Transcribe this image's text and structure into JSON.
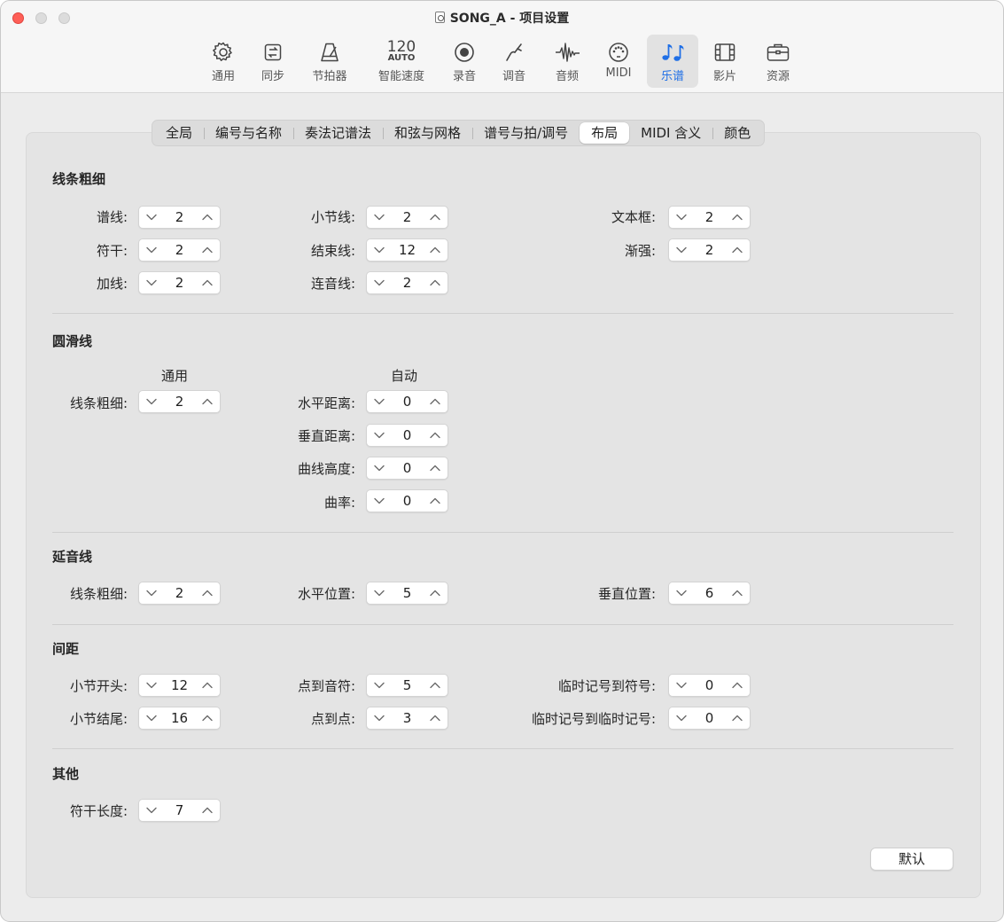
{
  "window": {
    "title": "SONG_A - 项目设置"
  },
  "toolbar": {
    "items": [
      {
        "label": "通用",
        "icon": "gear-icon"
      },
      {
        "label": "同步",
        "icon": "sync-icon"
      },
      {
        "label": "节拍器",
        "icon": "metronome-icon"
      },
      {
        "label": "智能速度",
        "icon": "tempo-icon",
        "tempo_value": "120",
        "tempo_mode": "AUTO"
      },
      {
        "label": "录音",
        "icon": "record-icon"
      },
      {
        "label": "调音",
        "icon": "tuning-fork-icon"
      },
      {
        "label": "音频",
        "icon": "waveform-icon"
      },
      {
        "label": "MIDI",
        "icon": "midi-port-icon"
      },
      {
        "label": "乐谱",
        "icon": "score-notes-icon",
        "active": true
      },
      {
        "label": "影片",
        "icon": "film-icon"
      },
      {
        "label": "资源",
        "icon": "briefcase-icon"
      }
    ],
    "active_color": "#1f6fe6"
  },
  "tabs": [
    "全局",
    "编号与名称",
    "奏法记谱法",
    "和弦与网格",
    "谱号与拍/调号",
    "布局",
    "MIDI 含义",
    "颜色"
  ],
  "active_tab": "布局",
  "sections": {
    "line_width": {
      "title": "线条粗细",
      "staff": {
        "label": "谱线:",
        "value": "2"
      },
      "stem": {
        "label": "符干:",
        "value": "2"
      },
      "ledger": {
        "label": "加线:",
        "value": "2"
      },
      "barline": {
        "label": "小节线:",
        "value": "2"
      },
      "final_barline": {
        "label": "结束线:",
        "value": "12"
      },
      "tuplet": {
        "label": "连音线:",
        "value": "2"
      },
      "text_frame": {
        "label": "文本框:",
        "value": "2"
      },
      "crescendo": {
        "label": "渐强:",
        "value": "2"
      }
    },
    "slur": {
      "title": "圆滑线",
      "general_header": "通用",
      "auto_header": "自动",
      "line_width": {
        "label": "线条粗细:",
        "value": "2"
      },
      "h_distance": {
        "label": "水平距离:",
        "value": "0"
      },
      "v_distance": {
        "label": "垂直距离:",
        "value": "0"
      },
      "curve_height": {
        "label": "曲线高度:",
        "value": "0"
      },
      "curvature": {
        "label": "曲率:",
        "value": "0"
      }
    },
    "tie": {
      "title": "延音线",
      "line_width": {
        "label": "线条粗细:",
        "value": "2"
      },
      "h_position": {
        "label": "水平位置:",
        "value": "5"
      },
      "v_position": {
        "label": "垂直位置:",
        "value": "6"
      }
    },
    "spacing": {
      "title": "间距",
      "bar_start": {
        "label": "小节开头:",
        "value": "12"
      },
      "bar_end": {
        "label": "小节结尾:",
        "value": "16"
      },
      "dot_to_note": {
        "label": "点到音符:",
        "value": "5"
      },
      "dot_to_dot": {
        "label": "点到点:",
        "value": "3"
      },
      "acc_to_symbol": {
        "label": "临时记号到符号:",
        "value": "0"
      },
      "acc_to_acc": {
        "label": "临时记号到临时记号:",
        "value": "0"
      }
    },
    "other": {
      "title": "其他",
      "stem_length": {
        "label": "符干长度:",
        "value": "7"
      }
    }
  },
  "default_button": "默认"
}
